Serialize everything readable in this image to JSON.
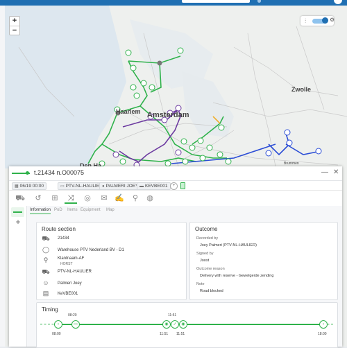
{
  "map": {
    "cities": [
      "Amsterdam",
      "Haarlem",
      "Zwolle",
      "Den Ha",
      "Brummen"
    ],
    "zoom_in": "+",
    "zoom_out": "−",
    "tools_icon": "filter-icon",
    "settings_icon": "gear-icon"
  },
  "panel": {
    "title": "t.21434 n.O00075",
    "controls": {
      "minimize": "—",
      "close": "✕"
    },
    "chips": {
      "datetime": "06/19 00:00",
      "haulier": "PTV-NL-HAULIER",
      "driver": "PALMERI JOEY",
      "vehicle": "KEVBE001"
    },
    "subtabs": [
      "Information",
      "PoD",
      "Items",
      "Equipment",
      "Map"
    ],
    "route_section": {
      "heading": "Route section",
      "rows": [
        {
          "icon": "truck-icon",
          "text": "21434"
        },
        {
          "icon": "depot-icon",
          "text": "Warehouse PTV Nederland BV - D1"
        },
        {
          "icon": "location-pin-icon",
          "text": "Klantnaam-AF",
          "sub": "HORST"
        },
        {
          "icon": "haulier-icon",
          "text": "PTV-NL-HAULIER"
        },
        {
          "icon": "driver-icon",
          "text": "Palmeri Joey"
        },
        {
          "icon": "vehicle-icon",
          "text": "KeVBE001"
        }
      ]
    },
    "outcome": {
      "heading": "Outcome",
      "fields": [
        {
          "label": "Recorded by",
          "value": "Joey Palmeri (PTV-NL-HAULIER)"
        },
        {
          "label": "Signed by",
          "value": "Joost"
        },
        {
          "label": "Outcome reason",
          "value": "Delivery with reserve - Gewelgerde zending"
        },
        {
          "label": "Note",
          "value": "Road blocked"
        }
      ]
    },
    "timing": {
      "heading": "Timing",
      "labels_top": [
        "08:20",
        "11:51"
      ],
      "labels_bottom": [
        "08:00",
        "11:51",
        "11:51",
        "18:00"
      ]
    }
  }
}
